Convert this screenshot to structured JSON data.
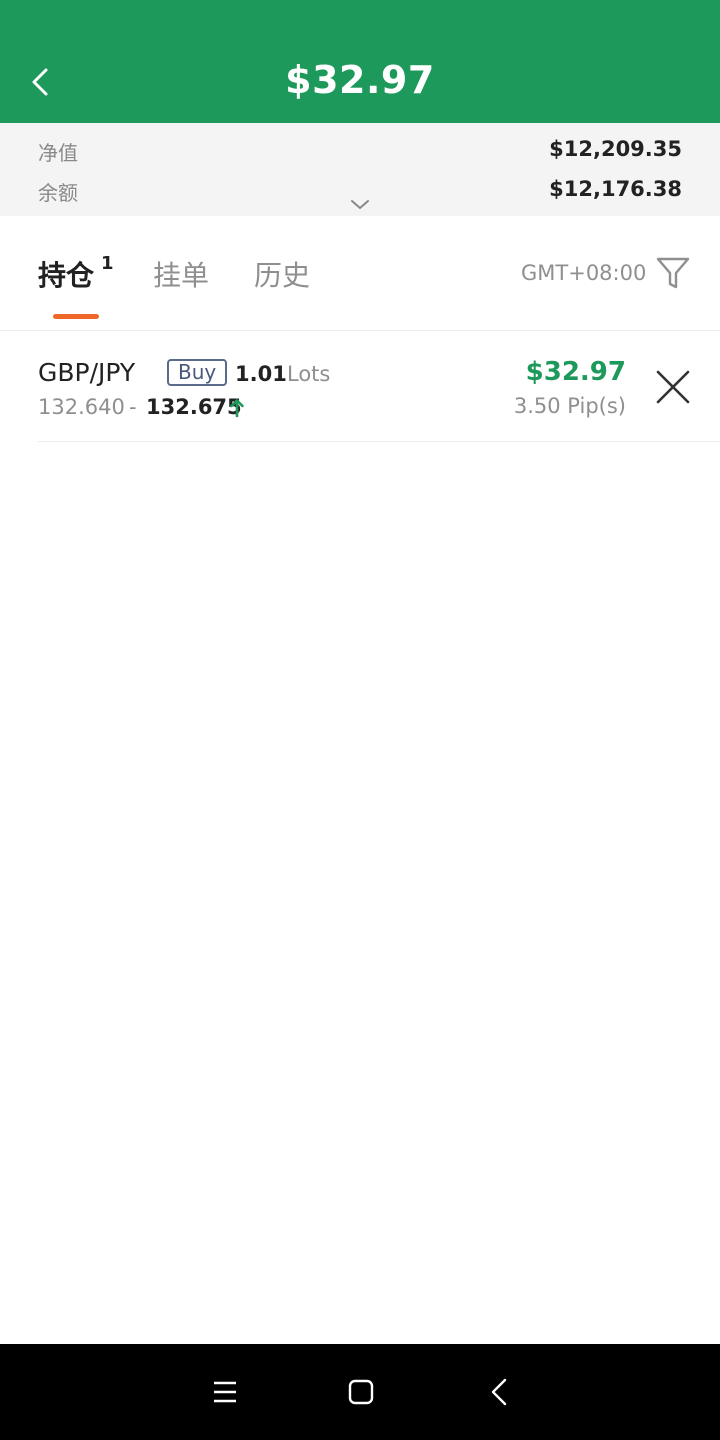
{
  "header": {
    "title": "$32.97"
  },
  "summary": {
    "equity_label": "净值",
    "equity_value": "$12,209.35",
    "balance_label": "余额",
    "balance_value": "$12,176.38"
  },
  "tabs": {
    "items": [
      {
        "label": "持仓",
        "badge": "1",
        "active": true
      },
      {
        "label": "挂单",
        "active": false
      },
      {
        "label": "历史",
        "active": false
      }
    ],
    "timezone": "GMT+08:00"
  },
  "positions": [
    {
      "symbol": "GBP/JPY",
      "side": "Buy",
      "lots": "1.01",
      "lots_unit": "Lots",
      "open_price": "132.640",
      "separator": "-",
      "current_price": "132.675",
      "profit": "$32.97",
      "pips": "3.50 Pip(s)"
    }
  ],
  "colors": {
    "brand": "#1d9a5b",
    "accent": "#f0672a",
    "profit": "#1d9a5b"
  },
  "icons": [
    "back-arrow-icon",
    "chevron-down-icon",
    "filter-icon",
    "up-arrow-icon",
    "close-icon",
    "menu-icon",
    "home-icon",
    "nav-back-icon"
  ]
}
